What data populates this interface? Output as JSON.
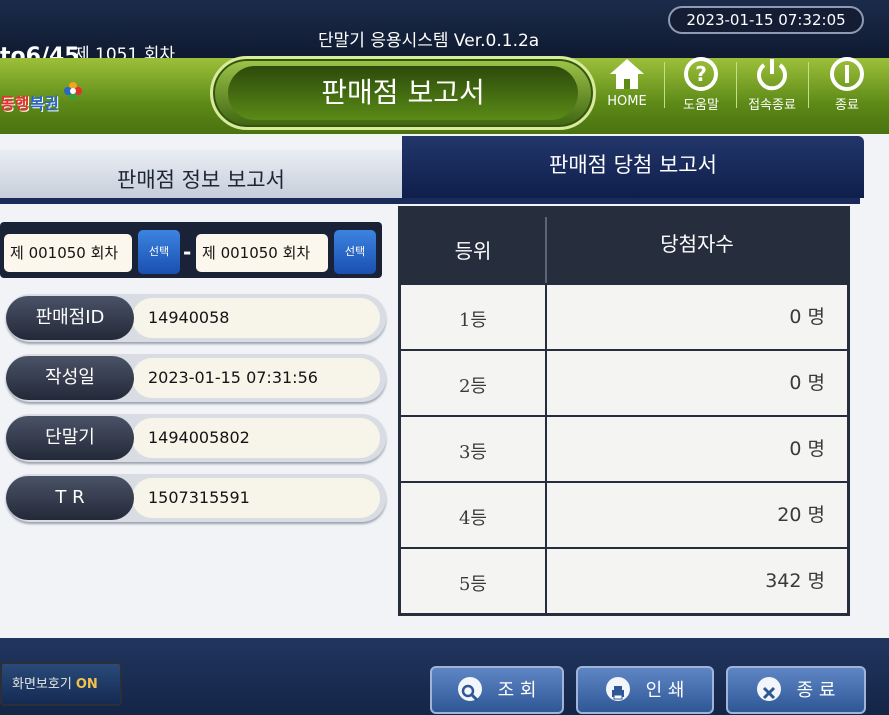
{
  "topbar": {
    "lotto_id": "to6/45",
    "round": "제 1051 회차",
    "app_title": "단말기 응용시스템  Ver.0.1.2a",
    "clock": "2023-01-15  07:32:05"
  },
  "header": {
    "logo_text_1": "동행",
    "logo_text_2": "복권",
    "title": "판매점 보고서",
    "buttons": {
      "home": "HOME",
      "help": "도움말",
      "disconnect": "접속종료",
      "exit": "종료"
    }
  },
  "tabs": {
    "store_info": "판매점 정보 보고서",
    "winning": "판매점 당첨 보고서"
  },
  "round_range": {
    "from": "제 001050 회차",
    "to": "제 001050 회차",
    "select_label": "선택",
    "separator": "-"
  },
  "fields": [
    {
      "label": "판매점ID",
      "value": "14940058"
    },
    {
      "label": "작성일",
      "value": "2023-01-15  07:31:56"
    },
    {
      "label": "단말기",
      "value": "1494005802"
    },
    {
      "label": "T R",
      "value": "1507315591"
    }
  ],
  "winners_table": {
    "headers": {
      "rank": "등위",
      "count": "당첨자수"
    },
    "rows": [
      {
        "rank": "1등",
        "count": "0 명"
      },
      {
        "rank": "2등",
        "count": "0 명"
      },
      {
        "rank": "3등",
        "count": "0 명"
      },
      {
        "rank": "4등",
        "count": "20 명"
      },
      {
        "rank": "5등",
        "count": "342 명"
      }
    ]
  },
  "bottom": {
    "screensaver_label": "화면보호기",
    "screensaver_state": "ON",
    "query": "조 회",
    "print": "인 쇄",
    "exit": "종 료"
  }
}
